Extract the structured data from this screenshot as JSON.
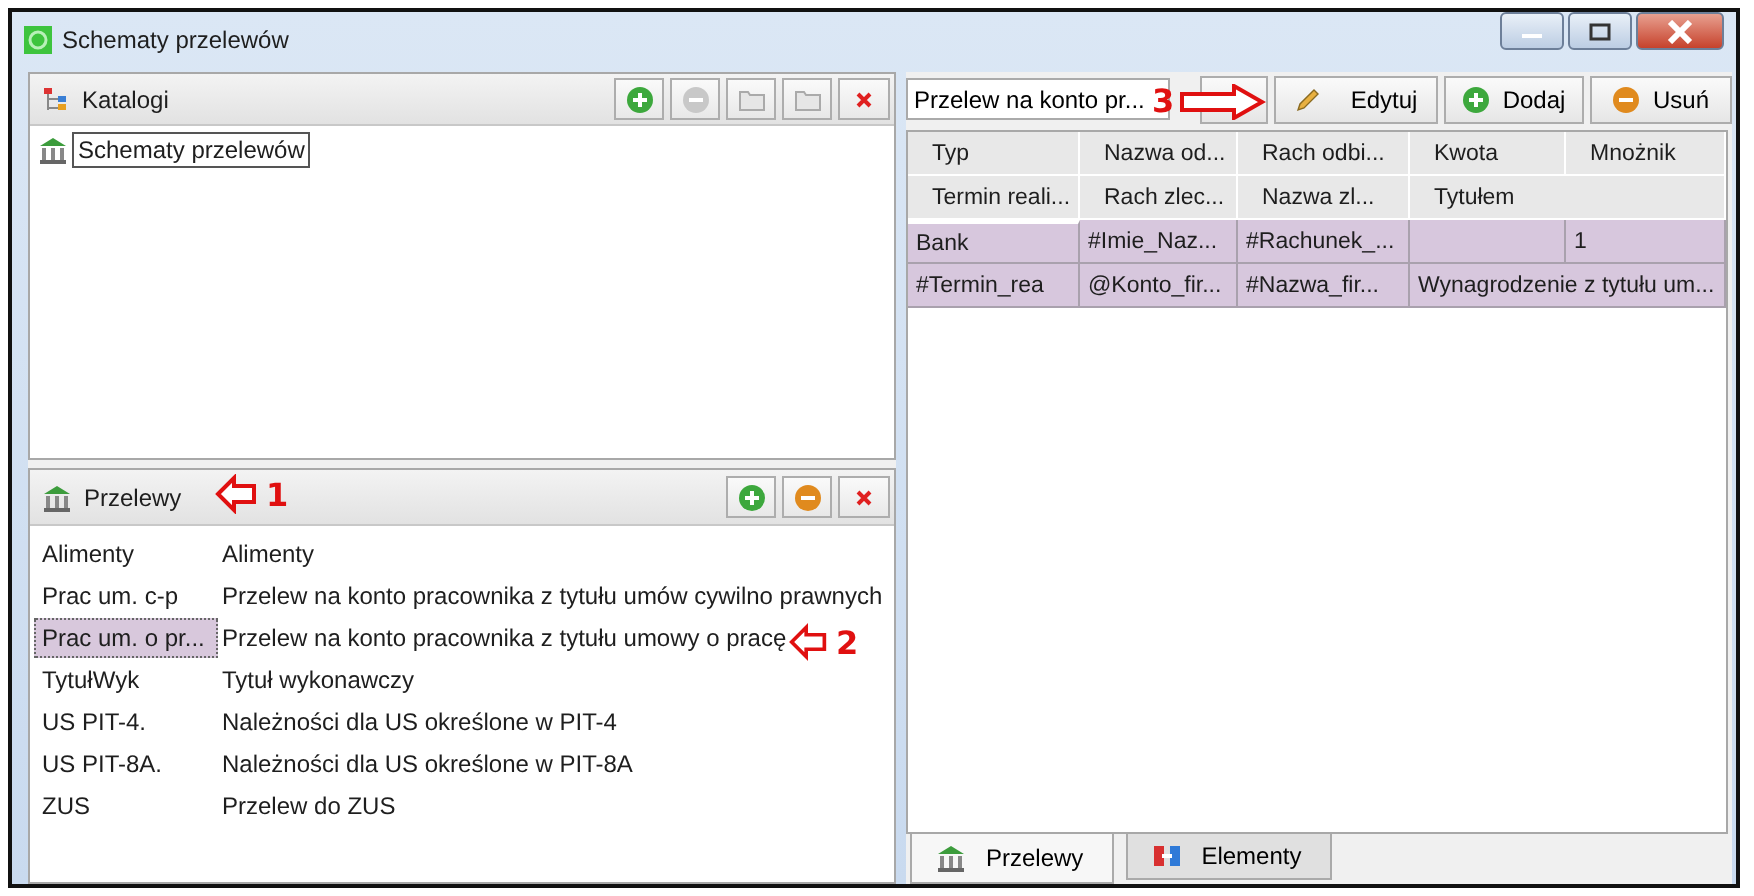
{
  "window": {
    "title": "Schematy przelewów"
  },
  "catalog_panel": {
    "title": "Katalogi",
    "tools": [
      {
        "kind": "add",
        "disabled": false
      },
      {
        "kind": "remove",
        "disabled": true
      },
      {
        "kind": "folder_add",
        "disabled": true
      },
      {
        "kind": "folder_remove",
        "disabled": true
      },
      {
        "kind": "close",
        "disabled": false
      }
    ],
    "tree": [
      {
        "label": "Schematy przelewów",
        "selected": true
      }
    ]
  },
  "transfers_panel": {
    "title": "Przelewy",
    "tools": [
      {
        "kind": "add",
        "disabled": false
      },
      {
        "kind": "remove",
        "disabled": false
      },
      {
        "kind": "close",
        "disabled": false
      }
    ],
    "rows": [
      {
        "code": "Alimenty",
        "name": "Alimenty",
        "selected": false
      },
      {
        "code": "Prac um. c-p",
        "name": "Przelew na konto pracownika z tytułu umów cywilno prawnych",
        "selected": false
      },
      {
        "code": "Prac um. o pr...",
        "name": "Przelew na konto pracownika z tytułu umowy o pracę",
        "selected": true
      },
      {
        "code": "TytułWyk",
        "name": "Tytuł wykonawczy",
        "selected": false
      },
      {
        "code": "US PIT-4.",
        "name": "Należności dla US określone w PIT-4",
        "selected": false
      },
      {
        "code": "US PIT-8A.",
        "name": "Należności dla US określone w PIT-8A",
        "selected": false
      },
      {
        "code": "ZUS",
        "name": "Przelew do ZUS",
        "selected": false
      }
    ]
  },
  "editor": {
    "search": {
      "value": "Przelew na konto pr..."
    },
    "buttons": [
      {
        "kind": "edit",
        "label": "Edytuj"
      },
      {
        "kind": "add",
        "label": "Dodaj"
      },
      {
        "kind": "remove",
        "label": "Usuń"
      }
    ],
    "header_rows": [
      [
        "Typ",
        "Nazwa od...",
        "Rach odbi...",
        "Kwota",
        "Mnożnik"
      ],
      [
        "Termin reali...",
        "Rach zlec...",
        "Nazwa zl...",
        "Tytułem"
      ]
    ],
    "rows": [
      [
        "Bank",
        "#Imie_Naz...",
        "#Rachunek_...",
        null,
        "1"
      ],
      [
        "#Termin_rea",
        "@Konto_fir...",
        "#Nazwa_fir...",
        "Wynagrodzenie z tytułu um..."
      ]
    ],
    "tabs": [
      {
        "kind": "transfers",
        "label": "Przelewy",
        "selected": true
      },
      {
        "kind": "elements",
        "label": "Elementy",
        "selected": false
      }
    ]
  },
  "annotations": [
    {
      "label": "1"
    },
    {
      "label": "2"
    },
    {
      "label": "3"
    }
  ]
}
